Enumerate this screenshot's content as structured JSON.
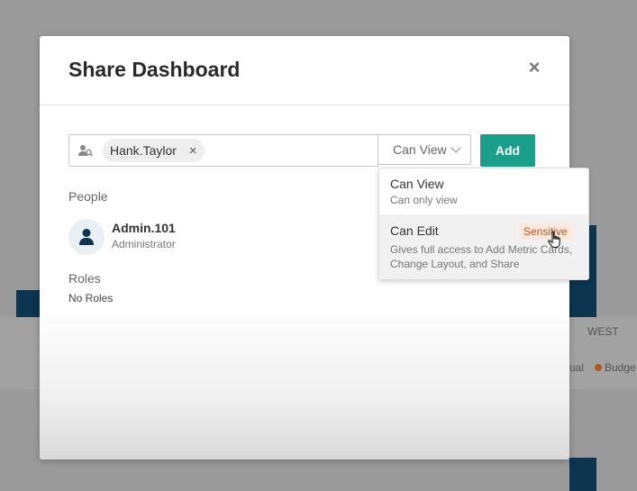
{
  "background": {
    "region_label": "WEST",
    "legend_actual": "ual",
    "legend_budget": "Budge"
  },
  "modal": {
    "title": "Share Dashboard",
    "close_glyph": "×"
  },
  "share_form": {
    "selected_user": "Hank.Taylor",
    "chip_remove_glyph": "×",
    "permission_value": "Can View",
    "add_label": "Add"
  },
  "people": {
    "label": "People",
    "users": [
      {
        "name": "Admin.101",
        "role": "Administrator"
      }
    ]
  },
  "roles": {
    "label": "Roles",
    "empty_text": "No Roles"
  },
  "permission_dropdown": {
    "options": [
      {
        "title": "Can View",
        "description": "Can only view"
      },
      {
        "title": "Can Edit",
        "description": "Gives full access to Add Metric Cards, Change Layout, and Share",
        "badge": "Sensitive"
      }
    ]
  },
  "colors": {
    "accent": "#1aa088",
    "badge_bg": "#fde8dc",
    "badge_text": "#b4541f",
    "avatar_icon": "#0c3550"
  }
}
